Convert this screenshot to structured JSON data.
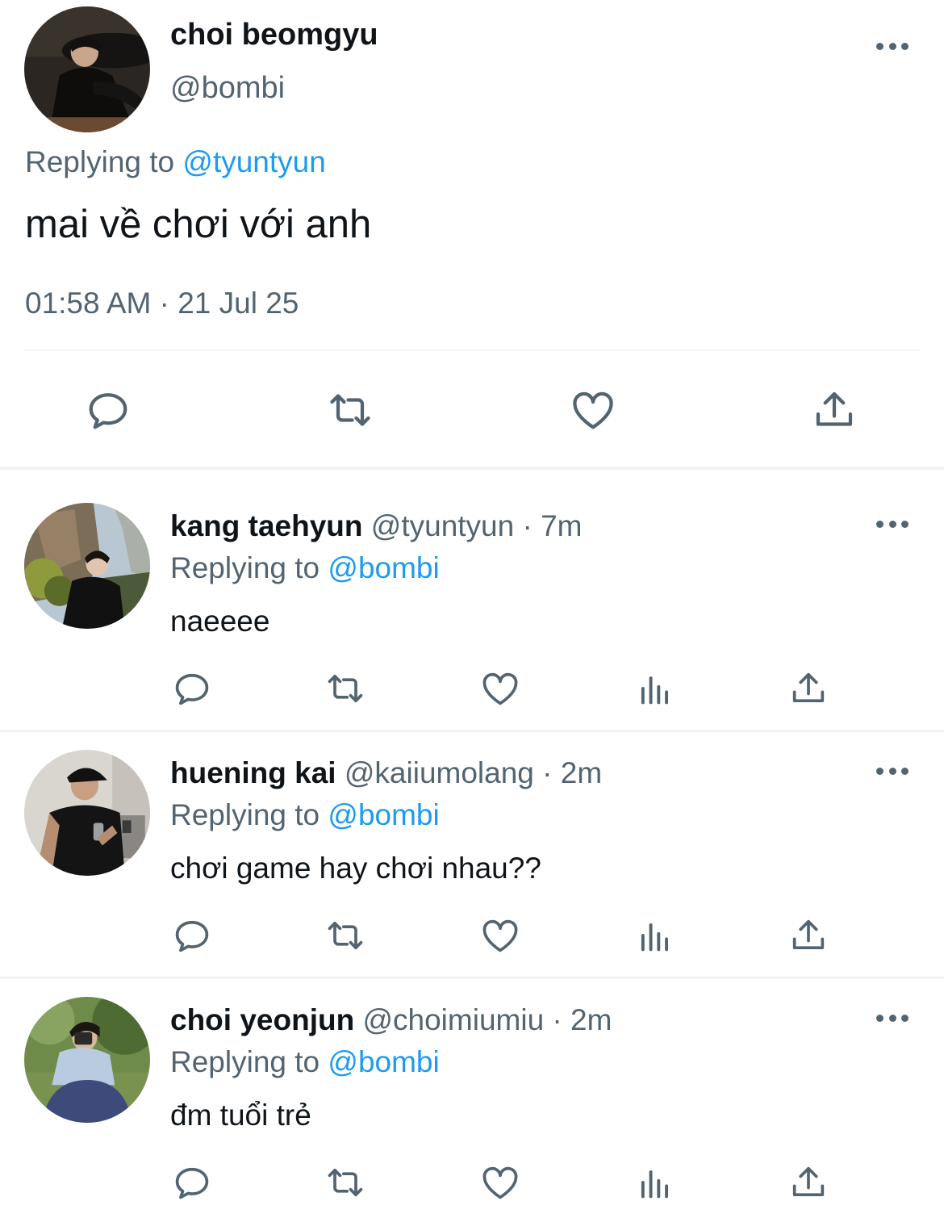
{
  "main_tweet": {
    "name": "choi beomgyu",
    "handle": "@bombi",
    "replying_label": "Replying to ",
    "replying_to": "@tyuntyun",
    "text": "mai về chơi với anh",
    "timestamp": "01:58 AM · 21 Jul 25",
    "actions": [
      "reply-icon",
      "retweet-icon",
      "like-icon",
      "share-icon"
    ]
  },
  "replies": [
    {
      "name": "kang taehyun",
      "handle": "@tyuntyun",
      "time": " · 7m",
      "replying_label": "Replying to ",
      "replying_to": "@bombi",
      "text": "naeeee"
    },
    {
      "name": "huening kai",
      "handle": "@kaiiumolang",
      "time": " · 2m",
      "replying_label": "Replying to ",
      "replying_to": "@bombi",
      "text": "chơi game hay chơi nhau??"
    },
    {
      "name": "choi yeonjun",
      "handle": "@choimiumiu",
      "time": " · 2m",
      "replying_label": "Replying to ",
      "replying_to": "@bombi",
      "text": "đm tuổi trẻ"
    }
  ],
  "reply_actions": [
    "reply-icon",
    "retweet-icon",
    "like-icon",
    "views-icon",
    "share-icon"
  ],
  "colors": {
    "text": "#0f1419",
    "secondary": "#536471",
    "mention": "#1d9bf0",
    "divider": "#eff3f4"
  }
}
